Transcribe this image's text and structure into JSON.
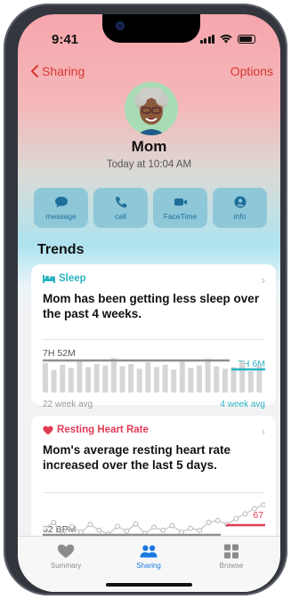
{
  "status_bar": {
    "time": "9:41"
  },
  "nav": {
    "back_label": "Sharing",
    "options_label": "Options"
  },
  "contact": {
    "name": "Mom",
    "last_updated": "Today at 10:04 AM"
  },
  "actions": [
    {
      "label": "message",
      "icon": "message-icon"
    },
    {
      "label": "call",
      "icon": "phone-icon"
    },
    {
      "label": "FaceTime",
      "icon": "video-icon"
    },
    {
      "label": "info",
      "icon": "person-icon"
    }
  ],
  "section_title": "Trends",
  "sleep_card": {
    "title": "Sleep",
    "message": "Mom has been getting less sleep over the past 4 weeks.",
    "baseline_label": "7H 52M",
    "recent_label": "7H 6M",
    "baseline_caption": "22 week avg",
    "recent_caption": "4 week avg",
    "accent": "#2ab3c2",
    "bars": [
      0.72,
      0.55,
      0.68,
      0.6,
      0.78,
      0.62,
      0.7,
      0.66,
      0.84,
      0.64,
      0.7,
      0.58,
      0.74,
      0.62,
      0.68,
      0.56,
      0.8,
      0.6,
      0.66,
      0.82,
      0.64,
      0.58,
      0.62,
      0.76,
      0.52,
      0.66
    ]
  },
  "heart_card": {
    "title": "Resting Heart Rate",
    "message": "Mom's average resting heart rate increased over the last 5 days.",
    "baseline_label": "62 BPM",
    "recent_label": "67",
    "accent": "#e23a55",
    "points": [
      0.35,
      0.5,
      0.2,
      0.4,
      0.25,
      0.45,
      0.3,
      0.2,
      0.4,
      0.28,
      0.46,
      0.22,
      0.38,
      0.3,
      0.42,
      0.25,
      0.35,
      0.3,
      0.5,
      0.55,
      0.45,
      0.6,
      0.72,
      0.85,
      0.95
    ]
  },
  "tab_bar": [
    {
      "label": "Summary",
      "icon": "heart-icon",
      "active": false
    },
    {
      "label": "Sharing",
      "icon": "people-icon",
      "active": true
    },
    {
      "label": "Browse",
      "icon": "grid-icon",
      "active": false
    }
  ]
}
